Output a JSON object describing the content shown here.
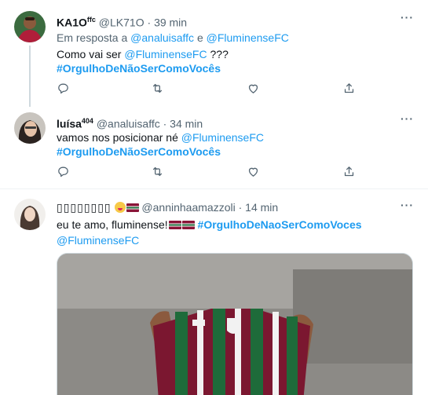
{
  "tweets": [
    {
      "name": "KA1O",
      "name_sup": "ffc",
      "handle": "@LK71O",
      "separator": "·",
      "time": "39 min",
      "reply_prefix": "Em resposta a",
      "reply_user1": "@analuisaffc",
      "reply_and": "e",
      "reply_user2": "@FluminenseFC",
      "text_before": "Como vai ser",
      "mention": "@FluminenseFC",
      "text_after": "???",
      "hashtag": "#OrgulhoDeNãoSerComoVocês"
    },
    {
      "name": "luísa",
      "name_sup": "404",
      "handle": "@analuisaffc",
      "separator": "·",
      "time": "34 min",
      "text_before": "vamos nos posicionar né",
      "mention": "@FluminenseFC",
      "hashtag": "#OrgulhoDeNãoSerComoVocês"
    },
    {
      "name": "𝐀𝐍𝐍𝐈𝐍𝐇𝐀",
      "name_placeholder_boxes": "▯▯▯▯▯▯▯▯",
      "handle": "@anninhaamazzoli",
      "separator": "·",
      "time": "14 min",
      "text_before": "eu te amo, fluminense!",
      "hashtag": "#OrgulhoDeNaoSerComoVoces",
      "mention": "@FluminenseFC"
    }
  ],
  "more_label": "···",
  "icons": [
    "reply-icon",
    "retweet-icon",
    "like-icon",
    "share-icon",
    "more-icon",
    "verified-thread-line"
  ],
  "colors": {
    "link": "#1d9bf0",
    "muted": "#536471",
    "divider": "#eff3f4",
    "fluminense_grena": "#8a1538",
    "fluminense_green": "#1e6b3a"
  }
}
